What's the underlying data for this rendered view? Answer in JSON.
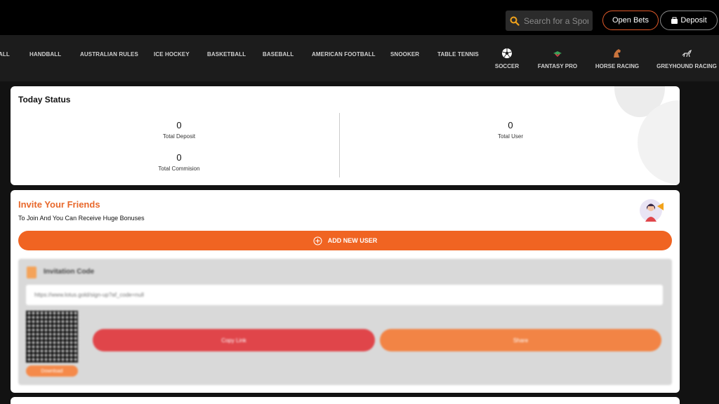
{
  "header": {
    "search_placeholder": "Search for a Sport",
    "open_bets_label": "Open Bets",
    "deposit_label": "Deposit",
    "accent_color": "#f06422"
  },
  "sports_nav": {
    "text_items": [
      "ALL",
      "HANDBALL",
      "AUSTRALIAN RULES",
      "ICE HOCKEY",
      "BASKETBALL",
      "BASEBALL",
      "AMERICAN FOOTBALL",
      "SNOOKER",
      "TABLE TENNIS"
    ],
    "icon_items": [
      {
        "label": "SOCCER",
        "icon": "soccer-ball-icon"
      },
      {
        "label": "FANTASY PRO",
        "icon": "fantasy-icon"
      },
      {
        "label": "HORSE RACING",
        "icon": "horse-icon"
      },
      {
        "label": "GREYHOUND RACING",
        "icon": "greyhound-icon"
      }
    ]
  },
  "today_status": {
    "title": "Today Status",
    "total_deposit": {
      "value": "0",
      "label": "Total Deposit"
    },
    "total_commision": {
      "value": "0",
      "label": "Total Commision"
    },
    "total_user": {
      "value": "0",
      "label": "Total User"
    }
  },
  "invite": {
    "title": "Invite Your Friends",
    "subtitle": "To Join And You Can Receive Huge Bonuses",
    "add_user_label": "ADD NEW USER",
    "invitation_code_label": "Invitation Code",
    "invitation_link": "https://www.lotus.gold/sign-up?af_code=null",
    "download_label": "Download",
    "copy_link_label": "Copy Link",
    "share_label": "Share"
  }
}
